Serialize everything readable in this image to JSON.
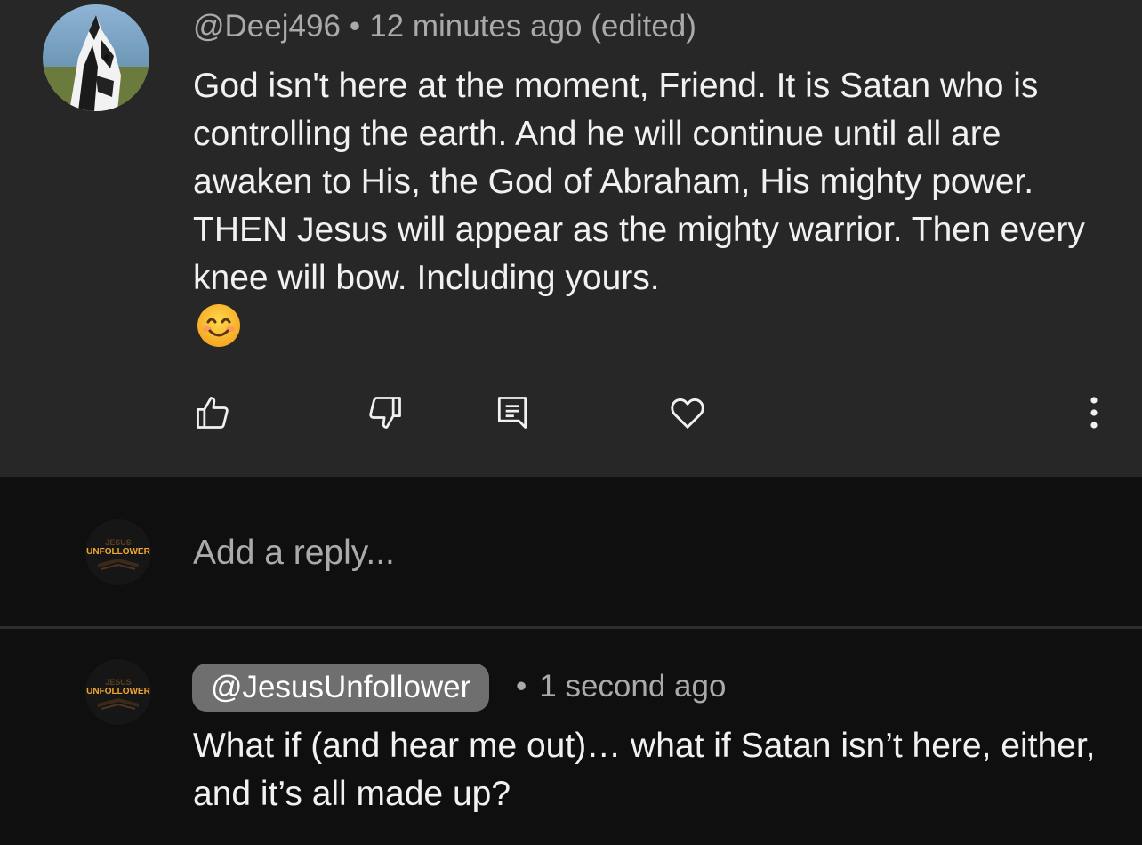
{
  "comment": {
    "author": "@Deej496",
    "separator": "•",
    "timestamp": "12 minutes ago (edited)",
    "text": "God isn't  here at the moment, Friend. It is Satan who is controlling the earth. And he will continue until all are awaken to His, the God of Abraham,  His mighty power. THEN Jesus will appear as the mighty warrior. Then every knee will bow. Including yours.",
    "emoji": "smiling-face-emoji"
  },
  "actions": {
    "like_icon": "thumbs-up-icon",
    "dislike_icon": "thumbs-down-icon",
    "reply_icon": "reply-comment-icon",
    "heart_icon": "heart-icon",
    "more_icon": "more-vertical-icon"
  },
  "channel_logo": {
    "line1": "JESUS",
    "line2": "UNFOLLOWER"
  },
  "reply_input": {
    "placeholder": "Add a reply..."
  },
  "reply": {
    "handle": "@JesusUnfollower",
    "separator": "•",
    "timestamp": "1 second ago",
    "text": "What if (and hear me out)… what if Satan isn’t here, either, and it’s all made up?"
  },
  "colors": {
    "card_bg": "#272727",
    "page_bg": "#0f0f0f",
    "secondary_text": "#aaaaaa",
    "chip_bg": "#6f6f6f",
    "logo_orange": "#f0a830",
    "logo_red": "#d8351f"
  }
}
